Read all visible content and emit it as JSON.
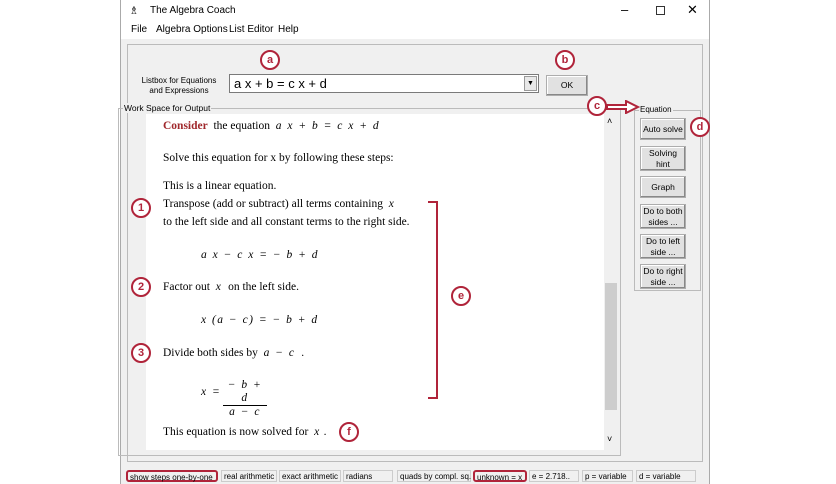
{
  "window": {
    "title": "The Algebra Coach",
    "icons": [
      "app-icon",
      "minimize-icon",
      "maximize-icon",
      "close-icon"
    ]
  },
  "menu": [
    "File",
    "Algebra Options",
    "List Editor",
    "Help"
  ],
  "listbox": {
    "label_line1": "Listbox for Equations",
    "label_line2": "and Expressions",
    "value": "a x + b = c x + d",
    "ok": "OK"
  },
  "workspace": {
    "title": "Work Space for Output",
    "consider": "Consider",
    "consider_rest": "the equation",
    "eq0": "a x + b = c x + d",
    "solve": "Solve this equation for x by following these steps:",
    "linear": "This is a linear equation.",
    "step1_l1": "Transpose (add or subtract) all terms containing",
    "step1_var": "x",
    "step1_l2": "to the left side and all constant terms to the right side.",
    "eq1": "a x − c x =  − b + d",
    "step2_a": "Factor out",
    "step2_var": "x",
    "step2_b": "on the left side.",
    "eq2": "x (a − c) =  − b + d",
    "step3_a": "Divide both sides by",
    "step3_expr": "a − c",
    "step3_b": ".",
    "eq3_lhs": "x =",
    "eq3_num": "− b + d",
    "eq3_den": "a − c",
    "solved_a": "This equation is now solved for",
    "solved_var": "x",
    "solved_b": "."
  },
  "equation_panel": {
    "title": "Equation",
    "buttons": [
      {
        "l1": "Auto solve",
        "l2": ""
      },
      {
        "l1": "Solving",
        "l2": "hint"
      },
      {
        "l1": "Graph",
        "l2": ""
      },
      {
        "l1": "Do to both",
        "l2": "sides ..."
      },
      {
        "l1": "Do to left",
        "l2": "side ..."
      },
      {
        "l1": "Do to right",
        "l2": "side ..."
      }
    ]
  },
  "status": [
    "show steps one-by-one",
    "real arithmetic",
    "exact arithmetic",
    "radians",
    "quads by compl. sq.",
    "unknown = x",
    "e = 2.718..",
    "p = variable",
    "d = variable"
  ],
  "annotations": {
    "a": "a",
    "b": "b",
    "c": "c",
    "d": "d",
    "e": "e",
    "f": "f",
    "n1": "1",
    "n2": "2",
    "n3": "3"
  },
  "colors": {
    "annotation": "#b0243a",
    "consider": "#a0282c"
  }
}
